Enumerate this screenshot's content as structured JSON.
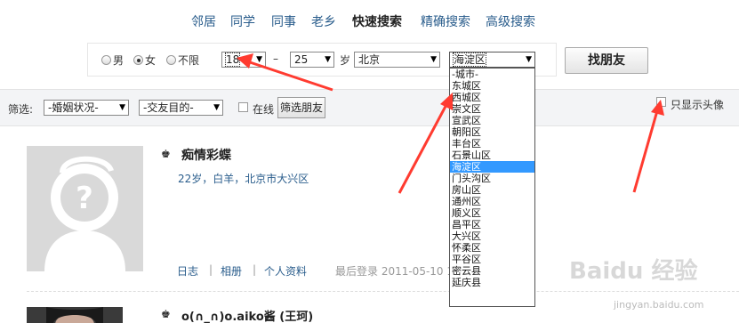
{
  "nav": {
    "tabs": [
      {
        "label": "邻居"
      },
      {
        "label": "同学"
      },
      {
        "label": "同事"
      },
      {
        "label": "老乡"
      },
      {
        "label": "快速搜索",
        "active": true
      },
      {
        "label": "精确搜索"
      },
      {
        "label": "高级搜索"
      }
    ]
  },
  "search": {
    "gender_options": [
      {
        "label": "男",
        "checked": false
      },
      {
        "label": "女",
        "checked": true
      },
      {
        "label": "不限",
        "checked": false
      }
    ],
    "age_from": "18",
    "age_separator": "–",
    "age_to": "25",
    "age_unit": "岁",
    "city": "北京",
    "district": "海淀区",
    "find_button": "找朋友"
  },
  "district_dropdown": {
    "options": [
      "-城市-",
      "东城区",
      "西城区",
      "崇文区",
      "宣武区",
      "朝阳区",
      "丰台区",
      "石景山区",
      "海淀区",
      "门头沟区",
      "房山区",
      "通州区",
      "顺义区",
      "昌平区",
      "大兴区",
      "怀柔区",
      "平谷区",
      "密云县",
      "延庆县"
    ],
    "selected": "海淀区"
  },
  "filter": {
    "label": "筛选:",
    "marital": "-婚姻状况-",
    "purpose": "-交友目的-",
    "online_label": "在线",
    "filter_button": "筛选朋友",
    "only_avatar_label": "只显示头像"
  },
  "results": [
    {
      "name": "痴情彩蝶",
      "info": "22岁，白羊，北京市大兴区",
      "links": [
        "日志",
        "相册",
        "个人资料"
      ],
      "last_login": "最后登录 2011-05-10 1"
    },
    {
      "name": "o(∩_∩)o.aiko酱 (王珂)"
    }
  ],
  "watermark": {
    "text": "Baidu 经验",
    "sub": "jingyan.baidu.com"
  },
  "colors": {
    "link": "#2a5d8c",
    "annotation_arrow": "#ff3b30",
    "dropdown_selected": "#3399ff"
  }
}
